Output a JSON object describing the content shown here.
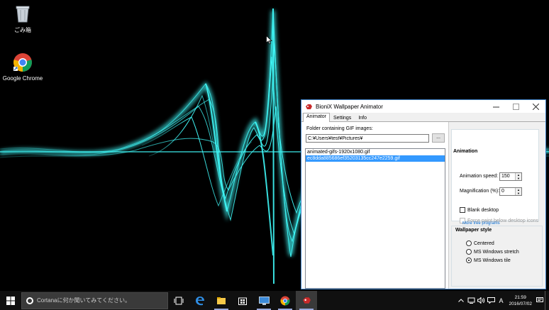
{
  "desktop": {
    "icons": [
      {
        "label": "ごみ箱",
        "icon": "recycle-bin-icon"
      },
      {
        "label": "Google Chrome",
        "icon": "chrome-icon"
      }
    ]
  },
  "window": {
    "title": "BioniX Wallpaper Animator",
    "tabs": [
      {
        "label": "Animator",
        "active": true
      },
      {
        "label": "Settings",
        "active": false
      },
      {
        "label": "Info",
        "active": false
      }
    ],
    "folder": {
      "label": "Folder containing GIF images:",
      "value": "C:¥Users¥test¥Pictures¥",
      "browse_label": "..."
    },
    "files": [
      {
        "name": "animated-gifs-1920x1080.gif",
        "selected": false
      },
      {
        "name": "ec8dda885686ef35203135cc247e2259.gif",
        "selected": true
      }
    ],
    "animation": {
      "heading": "Animation",
      "speed_label": "Animation speed:",
      "speed_value": "150",
      "magnification_label": "Magnification (%):",
      "magnification_value": "0",
      "blank_desktop_label": "Blank desktop",
      "force_paint_label": "Force paint below desktop icons",
      "more_link": "More free programs"
    },
    "wallpaper_style": {
      "heading": "Wallpaper style",
      "options": [
        {
          "label": "Centered",
          "selected": false
        },
        {
          "label": "MS Windows stretch",
          "selected": false
        },
        {
          "label": "MS Windows tile",
          "selected": true
        }
      ]
    }
  },
  "taskbar": {
    "search_placeholder": "Cortanaに何か聞いてみてください。",
    "apps": [
      "task-view-icon",
      "edge-icon",
      "file-explorer-icon",
      "store-icon",
      "remote-desktop-icon",
      "chrome-icon",
      "bionix-icon"
    ],
    "ime_indicator": "A",
    "time": "21:59",
    "date": "2016/07/02"
  },
  "colors": {
    "accent": "#3399ff",
    "wave": "#3ff6f6",
    "taskbar": "#101010"
  }
}
